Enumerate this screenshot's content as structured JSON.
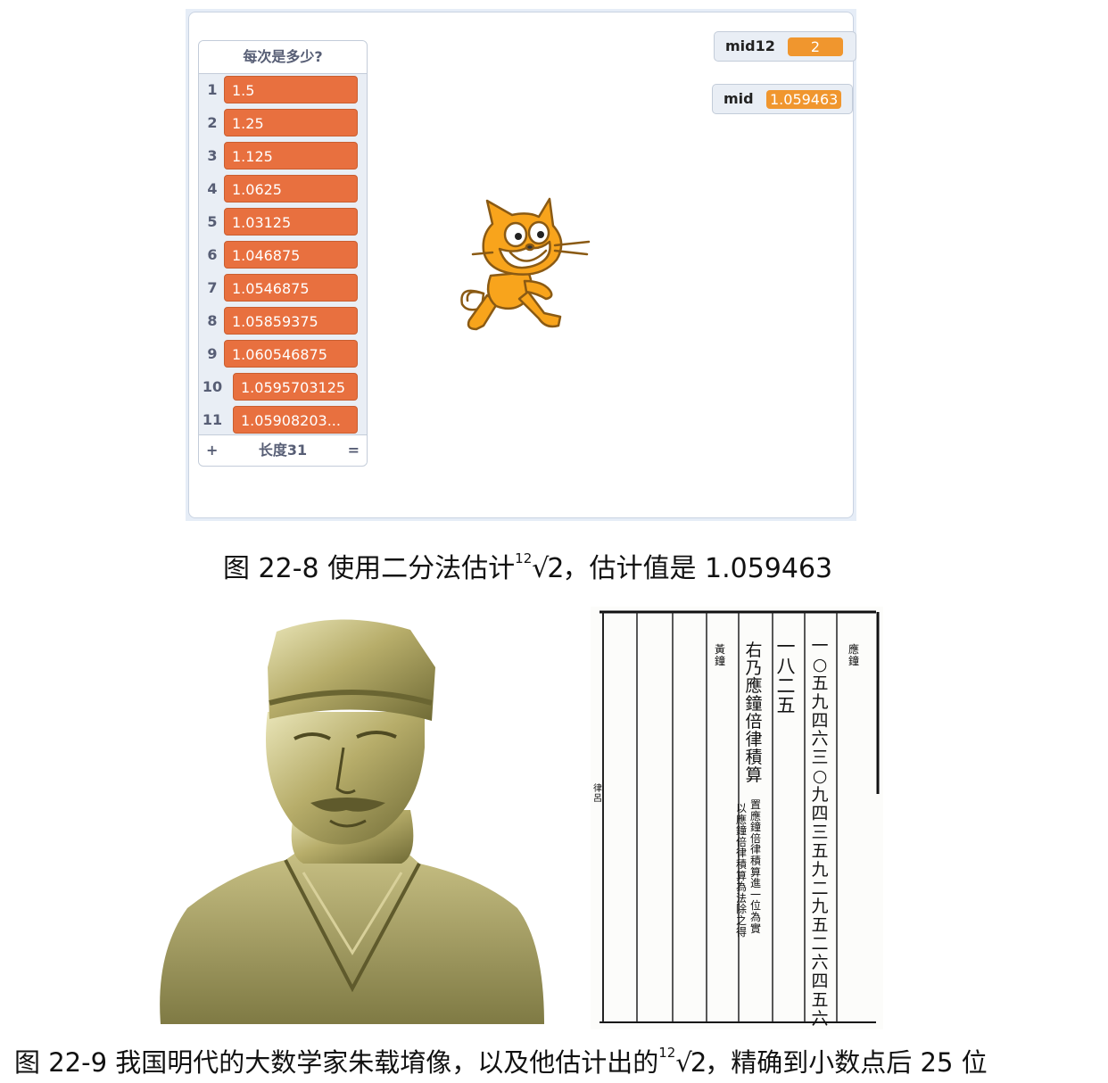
{
  "scratch": {
    "list": {
      "title": "每次是多少?",
      "items": [
        {
          "index": "1",
          "value": "1.5"
        },
        {
          "index": "2",
          "value": "1.25"
        },
        {
          "index": "3",
          "value": "1.125"
        },
        {
          "index": "4",
          "value": "1.0625"
        },
        {
          "index": "5",
          "value": "1.03125"
        },
        {
          "index": "6",
          "value": "1.046875"
        },
        {
          "index": "7",
          "value": "1.0546875"
        },
        {
          "index": "8",
          "value": "1.05859375"
        },
        {
          "index": "9",
          "value": "1.060546875"
        },
        {
          "index": "10",
          "value": "1.0595703125"
        },
        {
          "index": "11",
          "value": "1.05908203..."
        }
      ],
      "add_symbol": "+",
      "length_label": "长度31",
      "resize_symbol": "="
    },
    "variables": [
      {
        "name": "mid12",
        "value": "2"
      },
      {
        "name": "mid",
        "value": "1.059463"
      }
    ],
    "value_color": "#e8703f",
    "variable_color": "#f0962e"
  },
  "caption1": {
    "prefix": "图 22-8 使用二分法估计",
    "root_index": "12",
    "root_body": "√2",
    "suffix": "，估计值是 1.059463"
  },
  "caption2": {
    "prefix": "图 22-9 我国明代的大数学家朱载堉像，以及他估计出的",
    "root_index": "12",
    "root_body": "√2",
    "suffix": "，精确到小数点后 25 位"
  },
  "manuscript": {
    "col_label_1": "應鐘",
    "col_digits": "一○五九四六三○九四三五九二九五二六四五六",
    "col_number_2": "一八二五",
    "col_main": "右乃應鐘倍律積算",
    "col_note_a": "置應鐘倍律積算進一位為實",
    "col_note_b": "以應鐘倍律積算為法除之得",
    "col_label_2": "黃鐘",
    "side_marks": "律呂"
  }
}
